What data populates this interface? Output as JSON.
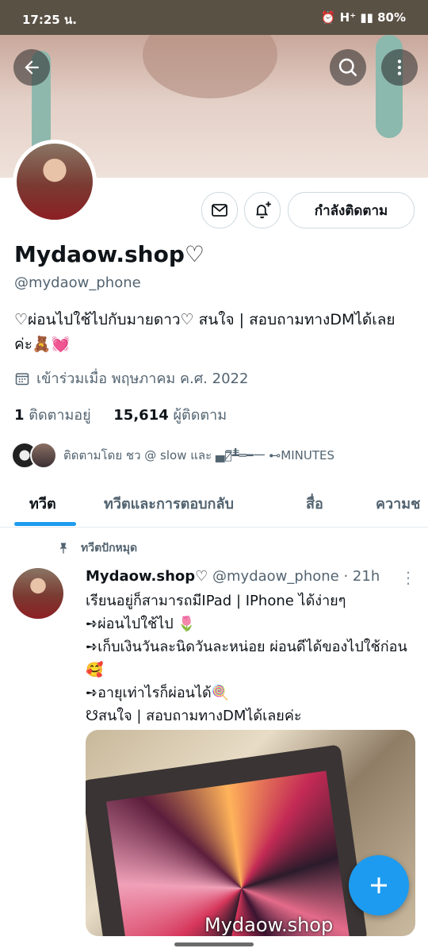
{
  "status_bar": {
    "time": "17:25 น.",
    "indicators": "⏰ H⁺ ▮▮ 80%"
  },
  "header": {
    "back_icon": "back-arrow-icon",
    "search_icon": "search-icon",
    "more_icon": "more-vertical-icon"
  },
  "profile": {
    "name": "Mydaow.shop♡",
    "handle": "@mydaow_phone",
    "bio": "♡ผ่อนไปใช้ไปกับมายดาว♡ สนใจ | สอบถามทางDMได้เลยค่ะ🧸💓",
    "joined": "เข้าร่วมเมื่อ พฤษภาคม ค.ศ. 2022",
    "following_count": "1",
    "following_label": "ติดตามอยู่",
    "followers_count": "15,614",
    "followers_label": "ผู้ติดตาม",
    "followed_by": "ติดตามโดย ชว @ slow และ ▄︻̷̿┻̿═━一 ⊷MINUTES",
    "follow_button": "กำลังติดตาม"
  },
  "tabs": [
    {
      "label": "ทวีต",
      "active": true
    },
    {
      "label": "ทวีตและการตอบกลับ",
      "active": false
    },
    {
      "label": "สื่อ",
      "active": false
    },
    {
      "label": "ความช",
      "active": false
    }
  ],
  "tweet": {
    "pinned_label": "ทวีตปักหมุด",
    "author_name": "Mydaow.shop♡",
    "author_handle": "@mydaow_phone",
    "time": "· 21h",
    "text": "เรียนอยู่ก็สามารถมีIPad | IPhone ได้ง่ายๆ\n➺ผ่อนไปใช้ไป 🌷\n➺เก็บเงินวันละนิดวันละหน่อย ผ่อนดีได้ของไปใช้ก่อน 🥰\n➺อายุเท่าไรก็ผ่อนได้🍭\n☋สนใจ | สอบถามทางDMได้เลยค่ะ",
    "media_watermark": "Mydaow.shop"
  },
  "colors": {
    "accent": "#1d9bf0",
    "status_bar": "#5a5145",
    "secondary_text": "#536471"
  }
}
